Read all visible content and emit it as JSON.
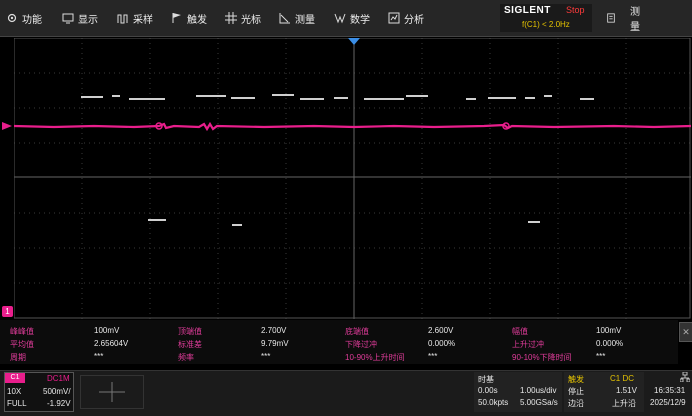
{
  "menu": {
    "items": [
      {
        "label": "功能",
        "icon": "settings-icon"
      },
      {
        "label": "显示",
        "icon": "display-icon"
      },
      {
        "label": "采样",
        "icon": "acquire-icon"
      },
      {
        "label": "触发",
        "icon": "trigger-flag-icon"
      },
      {
        "label": "光标",
        "icon": "cursor-icon"
      },
      {
        "label": "测量",
        "icon": "measure-icon"
      },
      {
        "label": "数学",
        "icon": "math-icon"
      },
      {
        "label": "分析",
        "icon": "analysis-icon"
      }
    ],
    "doc_label": "测量"
  },
  "brand": {
    "name": "SIGLENT",
    "state": "Stop",
    "trigger_condition": "f(C1) < 2.0Hz"
  },
  "channel_marker": "1",
  "measurements": [
    [
      {
        "label": "峰峰值",
        "value": "100mV"
      },
      {
        "label": "顶端值",
        "value": "2.700V"
      },
      {
        "label": "底端值",
        "value": "2.600V"
      },
      {
        "label": "幅值",
        "value": "100mV"
      }
    ],
    [
      {
        "label": "平均值",
        "value": "2.65604V"
      },
      {
        "label": "标准差",
        "value": "9.79mV"
      },
      {
        "label": "下降过冲",
        "value": "0.000%"
      },
      {
        "label": "上升过冲",
        "value": "0.000%"
      }
    ],
    [
      {
        "label": "周期",
        "value": "***"
      },
      {
        "label": "频率",
        "value": "***"
      },
      {
        "label": "10-90%上升时间",
        "value": "***"
      },
      {
        "label": "90-10%下降时间",
        "value": "***"
      }
    ]
  ],
  "channel": {
    "tag": "C1",
    "coupling": "DC1M",
    "probe": "10X",
    "scale": "500mV/",
    "bw": "FULL",
    "offset": "-1.92V"
  },
  "timebase": {
    "title": "时基",
    "delay": "0.00s",
    "scale": "1.00us/div",
    "points": "50.0kpts",
    "rate": "5.00GSa/s"
  },
  "trigger": {
    "title": "触发",
    "source": "C1 DC",
    "mode": "停止",
    "level": "1.51V",
    "type": "边沿",
    "slope": "上升沿"
  },
  "clock": {
    "time": "16:35:31",
    "date": "2025/12/9"
  },
  "colors": {
    "ch1": "#e91e8c",
    "label": "#e03c9a",
    "trigger": "#e6c400",
    "stop": "#ff3b3b"
  }
}
